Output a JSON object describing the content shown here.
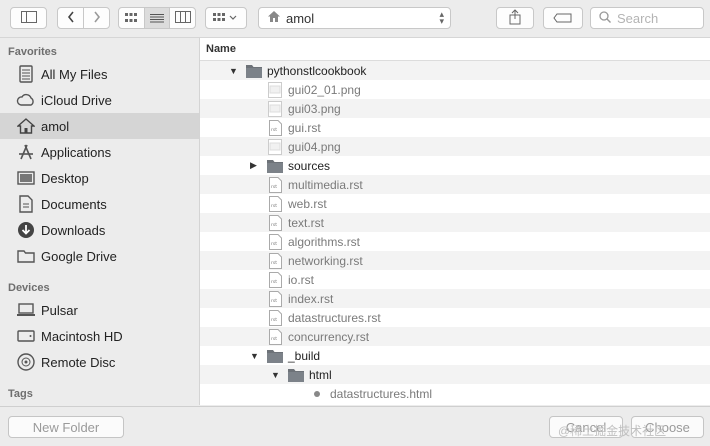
{
  "toolbar": {
    "location_label": "amol",
    "search_placeholder": "Search"
  },
  "sidebar": {
    "favorites_header": "Favorites",
    "favorites": [
      {
        "label": "All My Files",
        "icon": "all-files-icon"
      },
      {
        "label": "iCloud Drive",
        "icon": "cloud-icon"
      },
      {
        "label": "amol",
        "icon": "home-icon",
        "selected": true
      },
      {
        "label": "Applications",
        "icon": "applications-icon"
      },
      {
        "label": "Desktop",
        "icon": "desktop-icon"
      },
      {
        "label": "Documents",
        "icon": "documents-icon"
      },
      {
        "label": "Downloads",
        "icon": "downloads-icon"
      },
      {
        "label": "Google Drive",
        "icon": "folder-icon"
      }
    ],
    "devices_header": "Devices",
    "devices": [
      {
        "label": "Pulsar",
        "icon": "computer-icon"
      },
      {
        "label": "Macintosh HD",
        "icon": "hard-drive-icon"
      },
      {
        "label": "Remote Disc",
        "icon": "disc-icon"
      }
    ],
    "tags_header": "Tags"
  },
  "list": {
    "column_header": "Name",
    "rows": [
      {
        "name": "pythonstlcookbook",
        "type": "folder",
        "depth": 0,
        "expanded": true
      },
      {
        "name": "gui02_01.png",
        "type": "png",
        "depth": 1
      },
      {
        "name": "gui03.png",
        "type": "png",
        "depth": 1
      },
      {
        "name": "gui.rst",
        "type": "rst",
        "depth": 1
      },
      {
        "name": "gui04.png",
        "type": "png",
        "depth": 1
      },
      {
        "name": "sources",
        "type": "folder",
        "depth": 1,
        "expanded": false
      },
      {
        "name": "multimedia.rst",
        "type": "rst",
        "depth": 1
      },
      {
        "name": "web.rst",
        "type": "rst",
        "depth": 1
      },
      {
        "name": "text.rst",
        "type": "rst",
        "depth": 1
      },
      {
        "name": "algorithms.rst",
        "type": "rst",
        "depth": 1
      },
      {
        "name": "networking.rst",
        "type": "rst",
        "depth": 1
      },
      {
        "name": "io.rst",
        "type": "rst",
        "depth": 1
      },
      {
        "name": "index.rst",
        "type": "rst",
        "depth": 1
      },
      {
        "name": "datastructures.rst",
        "type": "rst",
        "depth": 1
      },
      {
        "name": "concurrency.rst",
        "type": "rst",
        "depth": 1
      },
      {
        "name": "_build",
        "type": "folder",
        "depth": 1,
        "expanded": true
      },
      {
        "name": "html",
        "type": "folder",
        "depth": 2,
        "expanded": true
      },
      {
        "name": "datastructures.html",
        "type": "html",
        "depth": 3
      }
    ]
  },
  "bottom": {
    "new_folder_label": "New Folder",
    "cancel_label": "Cancel",
    "choose_label": "Choose",
    "watermark": "@稀土掘金技术社区"
  },
  "colors": {
    "selection": "#d5d5d5",
    "folder": "#6d7278",
    "sidebar_bg": "#ececec"
  }
}
